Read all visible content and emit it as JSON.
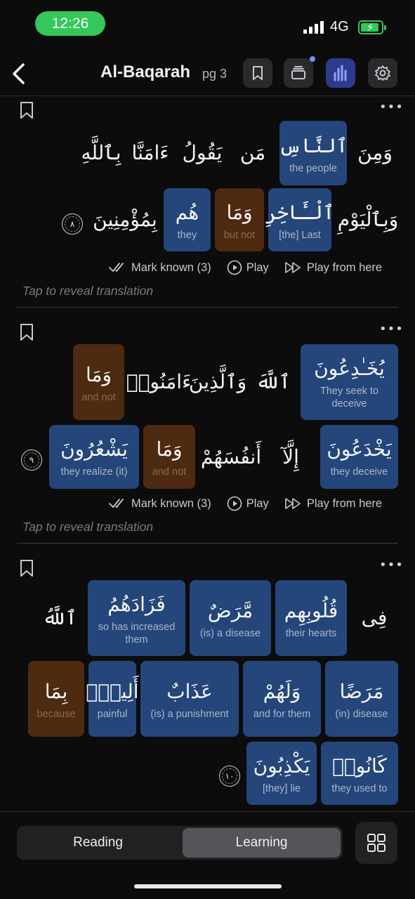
{
  "status_bar": {
    "time": "12:26",
    "network": "4G"
  },
  "header": {
    "title": "Al-Baqarah",
    "page": "pg 3",
    "icons": [
      "back-icon",
      "bookmark-icon",
      "layers-icon",
      "chart-icon",
      "settings-icon"
    ]
  },
  "actions": {
    "mark_known": "Mark known (3)",
    "play": "Play",
    "play_from_here": "Play from here"
  },
  "reveal_text": "Tap to reveal translation",
  "verses": [
    {
      "number": "٨",
      "words": [
        {
          "ar": "وَمِنَ",
          "en": ""
        },
        {
          "ar": "ٱلنَّاسِ",
          "en": "the people"
        },
        {
          "ar": "مَن",
          "en": ""
        },
        {
          "ar": "يَقُولُ",
          "en": ""
        },
        {
          "ar": "ءَامَنَّا",
          "en": ""
        },
        {
          "ar": "بِٱللَّهِ",
          "en": ""
        },
        {
          "ar": "وَبِٱلْيَوْمِ",
          "en": ""
        },
        {
          "ar": "ٱلْـَٔاخِرِ",
          "en": "[the] Last"
        },
        {
          "ar": "وَمَا",
          "en": "but not"
        },
        {
          "ar": "هُم",
          "en": "they"
        },
        {
          "ar": "بِمُؤْمِنِينَ",
          "en": ""
        }
      ]
    },
    {
      "number": "٩",
      "words": [
        {
          "ar": "يُخَـٰدِعُونَ",
          "en": "They seek to deceive"
        },
        {
          "ar": "ٱللَّهَ",
          "en": ""
        },
        {
          "ar": "وَٱلَّذِينَ",
          "en": ""
        },
        {
          "ar": "ءَامَنُوا۟",
          "en": ""
        },
        {
          "ar": "وَمَا",
          "en": "and not"
        },
        {
          "ar": "يَخْدَعُونَ",
          "en": "they deceive"
        },
        {
          "ar": "إِلَّآ",
          "en": ""
        },
        {
          "ar": "أَنفُسَهُمْ",
          "en": ""
        },
        {
          "ar": "وَمَا",
          "en": "and not"
        },
        {
          "ar": "يَشْعُرُونَ",
          "en": "they realize (it)"
        }
      ]
    },
    {
      "number": "١٠",
      "words": [
        {
          "ar": "فِى",
          "en": ""
        },
        {
          "ar": "قُلُوبِهِم",
          "en": "their hearts"
        },
        {
          "ar": "مَّرَضٌ",
          "en": "(is) a disease"
        },
        {
          "ar": "فَزَادَهُمُ",
          "en": "so has increased them"
        },
        {
          "ar": "ٱللَّهُ",
          "en": ""
        },
        {
          "ar": "مَرَضًا",
          "en": "(in) disease"
        },
        {
          "ar": "وَلَهُمْ",
          "en": "and for them"
        },
        {
          "ar": "عَذَابٌ",
          "en": "(is) a punishment"
        },
        {
          "ar": "أَلِيمٌۢ",
          "en": "painful"
        },
        {
          "ar": "بِمَا",
          "en": "because"
        },
        {
          "ar": "كَانُوا۟",
          "en": "they used to"
        },
        {
          "ar": "يَكْذِبُونَ",
          "en": "[they] lie"
        }
      ]
    }
  ],
  "bottom_bar": {
    "tabs": [
      "Reading",
      "Learning"
    ],
    "active_tab": "Learning"
  },
  "colors": {
    "known_word": "#24467a",
    "particle_word": "#4d2a10",
    "status_green": "#34c759",
    "active_header_button": "#2e3a8a"
  }
}
